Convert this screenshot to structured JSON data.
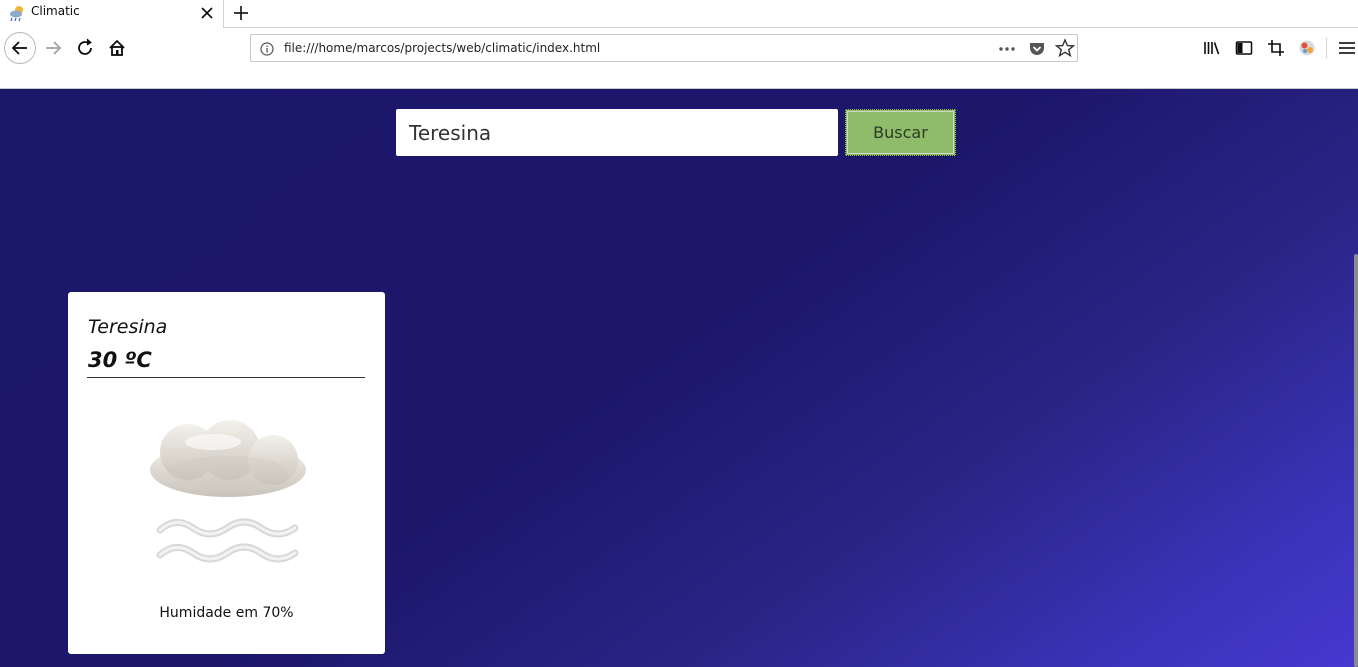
{
  "browser": {
    "tab": {
      "title": "Climatic"
    },
    "url": "file:///home/marcos/projects/web/climatic/index.html",
    "icons": {
      "favicon": "weather-app-icon",
      "close": "close-icon",
      "new_tab": "plus-icon",
      "back": "arrow-left-icon",
      "forward": "arrow-right-icon",
      "reload": "reload-icon",
      "home": "home-icon",
      "info": "info-icon",
      "page_actions": "more-dots-icon",
      "pocket": "pocket-icon",
      "bookmark": "star-icon",
      "library": "library-icon",
      "sidebar": "sidebar-icon",
      "screenshot": "crop-icon",
      "extension": "extension-icon",
      "menu": "hamburger-menu-icon"
    }
  },
  "search": {
    "value": "Teresina",
    "button_label": "Buscar"
  },
  "card": {
    "city": "Teresina",
    "temperature": "30 ºC",
    "weather_icon": "mist-cloud-icon",
    "humidity": "Humidade em 70%"
  },
  "colors": {
    "page_background_start": "#1b1769",
    "page_background_end": "#4638d0",
    "button_background": "#8fbc6b",
    "card_background": "#ffffff"
  }
}
